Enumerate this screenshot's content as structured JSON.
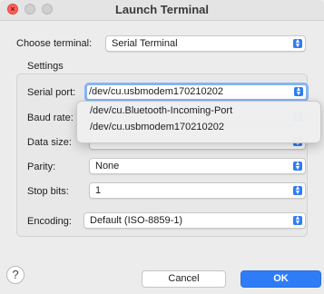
{
  "window": {
    "title": "Launch Terminal"
  },
  "choose_terminal": {
    "label": "Choose terminal:",
    "value": "Serial Terminal"
  },
  "settings": {
    "group_label": "Settings",
    "serial_port": {
      "label": "Serial port:",
      "value": "/dev/cu.usbmodem170210202"
    },
    "baud_rate": {
      "label": "Baud rate:"
    },
    "data_size": {
      "label": "Data size:"
    },
    "parity": {
      "label": "Parity:",
      "value": "None"
    },
    "stop_bits": {
      "label": "Stop bits:",
      "value": "1"
    },
    "encoding": {
      "label": "Encoding:",
      "value": "Default (ISO-8859-1)"
    }
  },
  "serial_port_dropdown": {
    "options": [
      "/dev/cu.Bluetooth-Incoming-Port",
      "/dev/cu.usbmodem170210202"
    ]
  },
  "buttons": {
    "help": "?",
    "cancel": "Cancel",
    "ok": "OK"
  },
  "colors": {
    "accent": "#2f7df6",
    "close": "#ff5f57"
  },
  "icons": {
    "help": "help-icon",
    "chevron": "chevron-updown-icon"
  }
}
